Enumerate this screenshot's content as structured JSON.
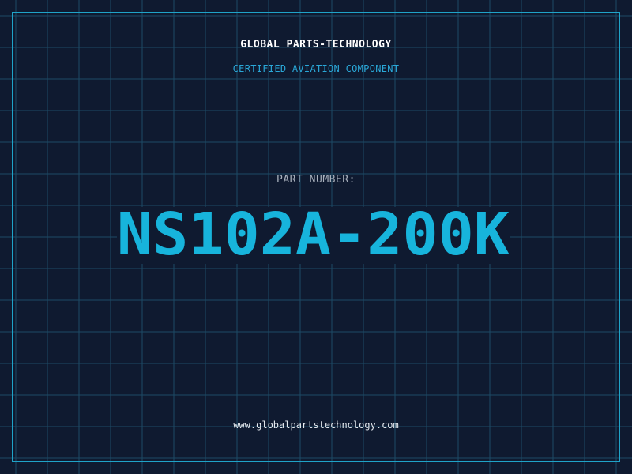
{
  "header": {
    "company": "GLOBAL PARTS-TECHNOLOGY",
    "subtitle": "CERTIFIED AVIATION COMPONENT"
  },
  "part": {
    "label": "PART NUMBER:",
    "number": "NS102A-200K"
  },
  "footer": {
    "url": "www.globalpartstechnology.com"
  },
  "colors": {
    "background": "#0f1a30",
    "grid": "#1c4a66",
    "frame": "#1fa3c8",
    "accent": "#17b4dc"
  }
}
